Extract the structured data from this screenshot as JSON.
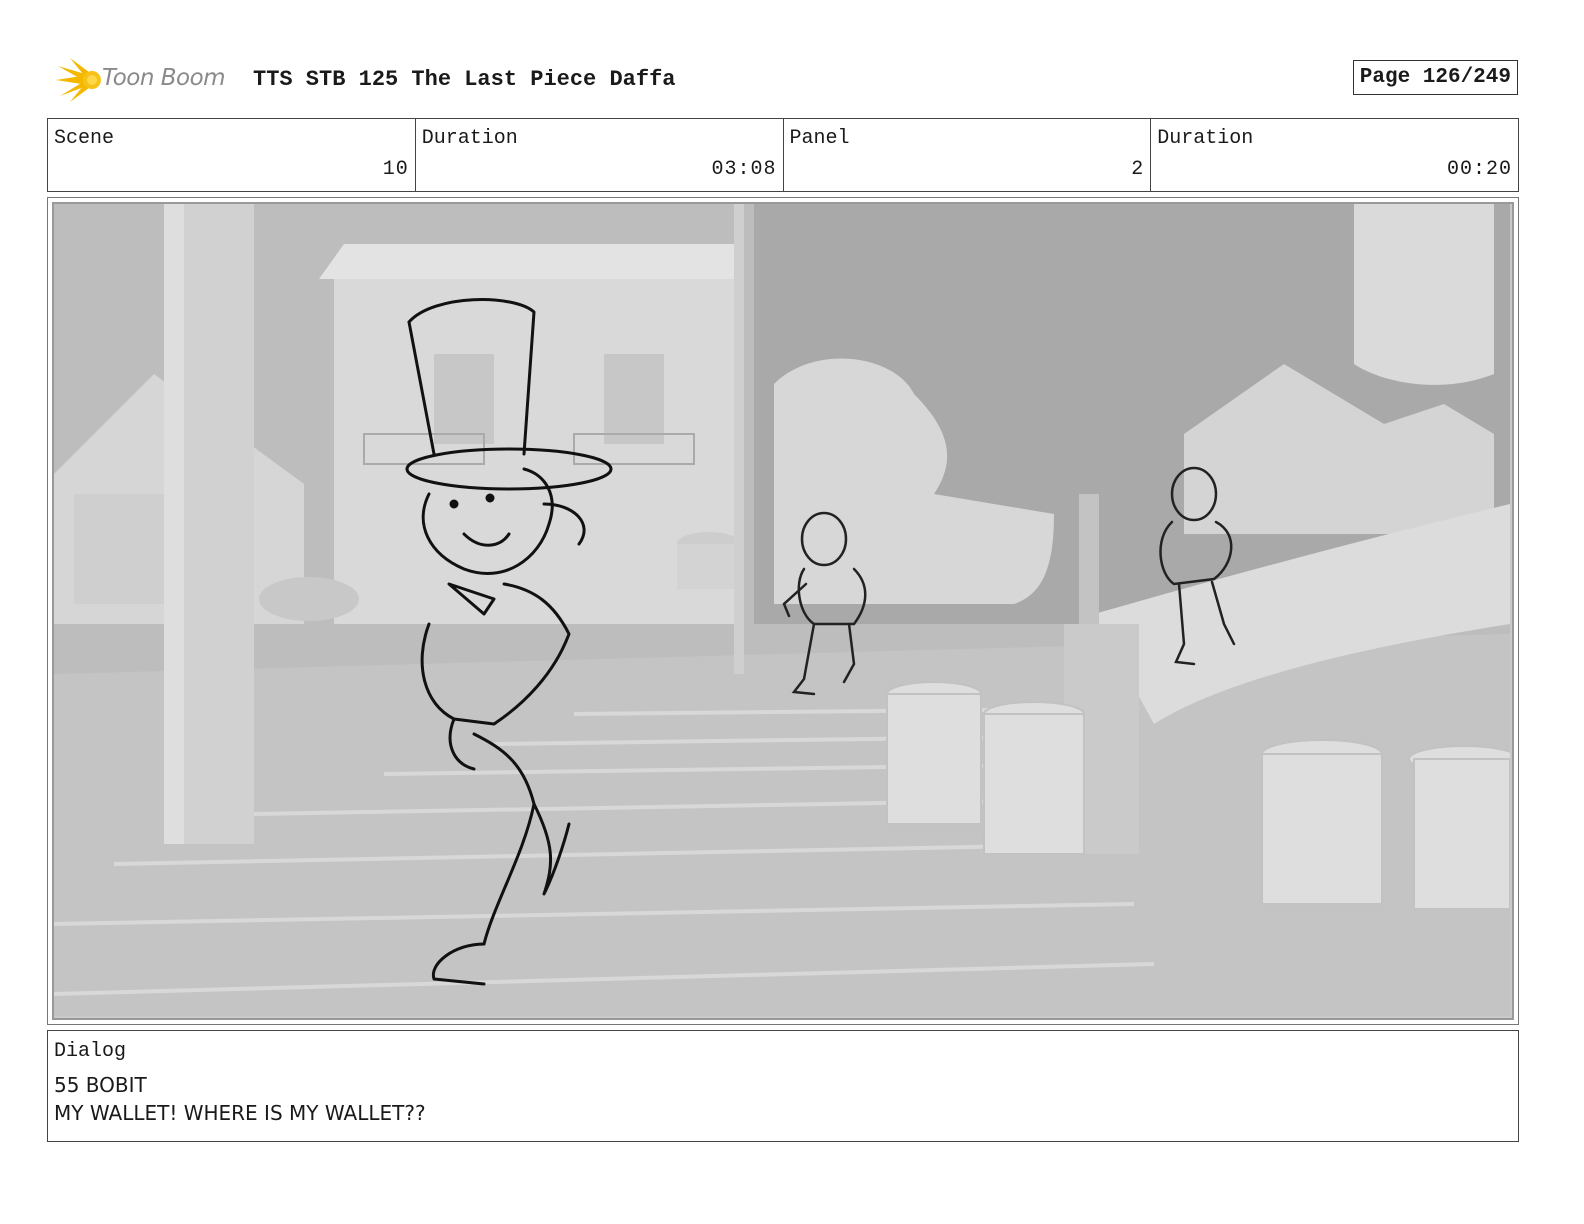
{
  "header": {
    "logo_text": "Toon Boom",
    "title": "TTS STB 125 The Last Piece Daffa",
    "page": "Page 126/249"
  },
  "info": [
    {
      "label": "Scene",
      "value": "10"
    },
    {
      "label": "Duration",
      "value": "03:08"
    },
    {
      "label": "Panel",
      "value": "2"
    },
    {
      "label": "Duration",
      "value": "00:20"
    }
  ],
  "dialog": {
    "label": "Dialog",
    "lines": [
      "55 BOBIT",
      "MY WALLET! WHERE IS MY WALLET??"
    ]
  }
}
